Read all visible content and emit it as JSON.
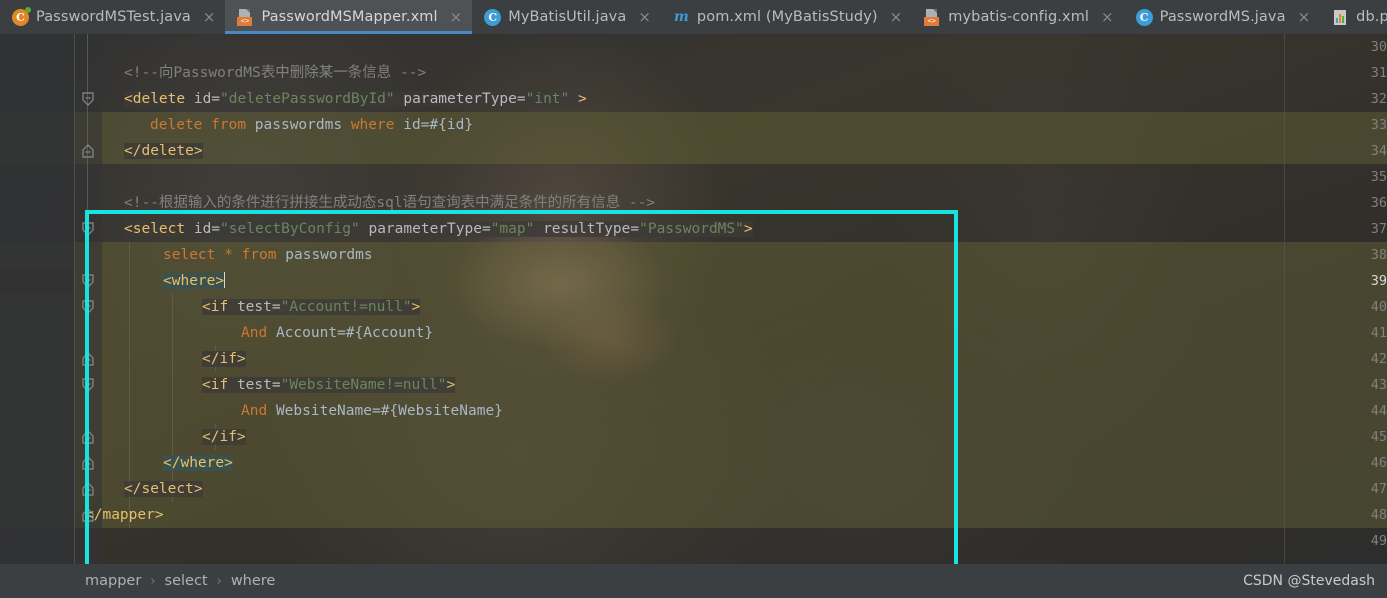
{
  "window": {
    "accent_blue": "#4a88c7",
    "callout_color": "#19e3e0",
    "selection_color": "#6b6838"
  },
  "tabs": [
    {
      "label": "PasswordMSTest.java",
      "icon": "java-test-class-icon",
      "icon_letter": "C",
      "active": false,
      "close_label": "×"
    },
    {
      "label": "PasswordMSMapper.xml",
      "icon": "xml-file-icon",
      "icon_letter": "<>",
      "active": true,
      "close_label": "×"
    },
    {
      "label": "MyBatisUtil.java",
      "icon": "java-class-icon",
      "icon_letter": "C",
      "active": false,
      "close_label": "×"
    },
    {
      "label": "pom.xml (MyBatisStudy)",
      "icon": "maven-file-icon",
      "icon_letter": "m",
      "active": false,
      "close_label": "×"
    },
    {
      "label": "mybatis-config.xml",
      "icon": "xml-file-icon",
      "icon_letter": "<>",
      "active": false,
      "close_label": "×"
    },
    {
      "label": "PasswordMS.java",
      "icon": "java-class-icon",
      "icon_letter": "C",
      "active": false,
      "close_label": "×"
    },
    {
      "label": "db.proper",
      "icon": "properties-file-icon",
      "icon_letter": "",
      "active": false,
      "close_label": ""
    }
  ],
  "editor": {
    "first_line_number": 30,
    "current_line_number": 39,
    "line_numbers": [
      30,
      31,
      32,
      33,
      34,
      35,
      36,
      37,
      38,
      39,
      40,
      41,
      42,
      43,
      44,
      45,
      46,
      47,
      48,
      49
    ],
    "lines": {
      "l31": "<!--向PasswordMS表中删除某一条信息 -->",
      "l32_tag": "<delete",
      "l32_attr1": "id=",
      "l32_val1": "\"deletePasswordById\"",
      "l32_attr2": "parameterType=",
      "l32_val2": "\"int\"",
      "l32_close": ">",
      "l33_kw1": "delete",
      "l33_kw2": "from",
      "l33_tbl": "passwordms",
      "l33_kw3": "where",
      "l33_rest": "id=#{id}",
      "l34": "</delete>",
      "l36": "<!--根据输入的条件进行拼接生成动态sql语句查询表中满足条件的所有信息 -->",
      "l37_tag": "<select",
      "l37_attr1": "id=",
      "l37_val1": "\"selectByConfig\"",
      "l37_attr2": "parameterType=",
      "l37_val2": "\"map\"",
      "l37_attr3": "resultType=",
      "l37_val3": "\"PasswordMS\"",
      "l37_close": ">",
      "l38_kw1": "select",
      "l38_star": "*",
      "l38_kw2": "from",
      "l38_tbl": "passwordms",
      "l39": "<where>",
      "l40_tag": "<if",
      "l40_attr": "test=",
      "l40_val": "\"Account!=null\"",
      "l40_close": ">",
      "l41_kw": "And",
      "l41_rest": "Account=#{Account}",
      "l42": "</if>",
      "l43_tag": "<if",
      "l43_attr": "test=",
      "l43_val": "\"WebsiteName!=null\"",
      "l43_close": ">",
      "l44_kw": "And",
      "l44_rest": "WebsiteName=#{WebsiteName}",
      "l45": "</if>",
      "l46": "</where>",
      "l47": "</select>",
      "l48": "</mapper>"
    }
  },
  "breadcrumb": {
    "items": [
      "mapper",
      "select",
      "where"
    ],
    "separator": "›"
  },
  "watermark": {
    "text": "CSDN @Stevedash"
  }
}
